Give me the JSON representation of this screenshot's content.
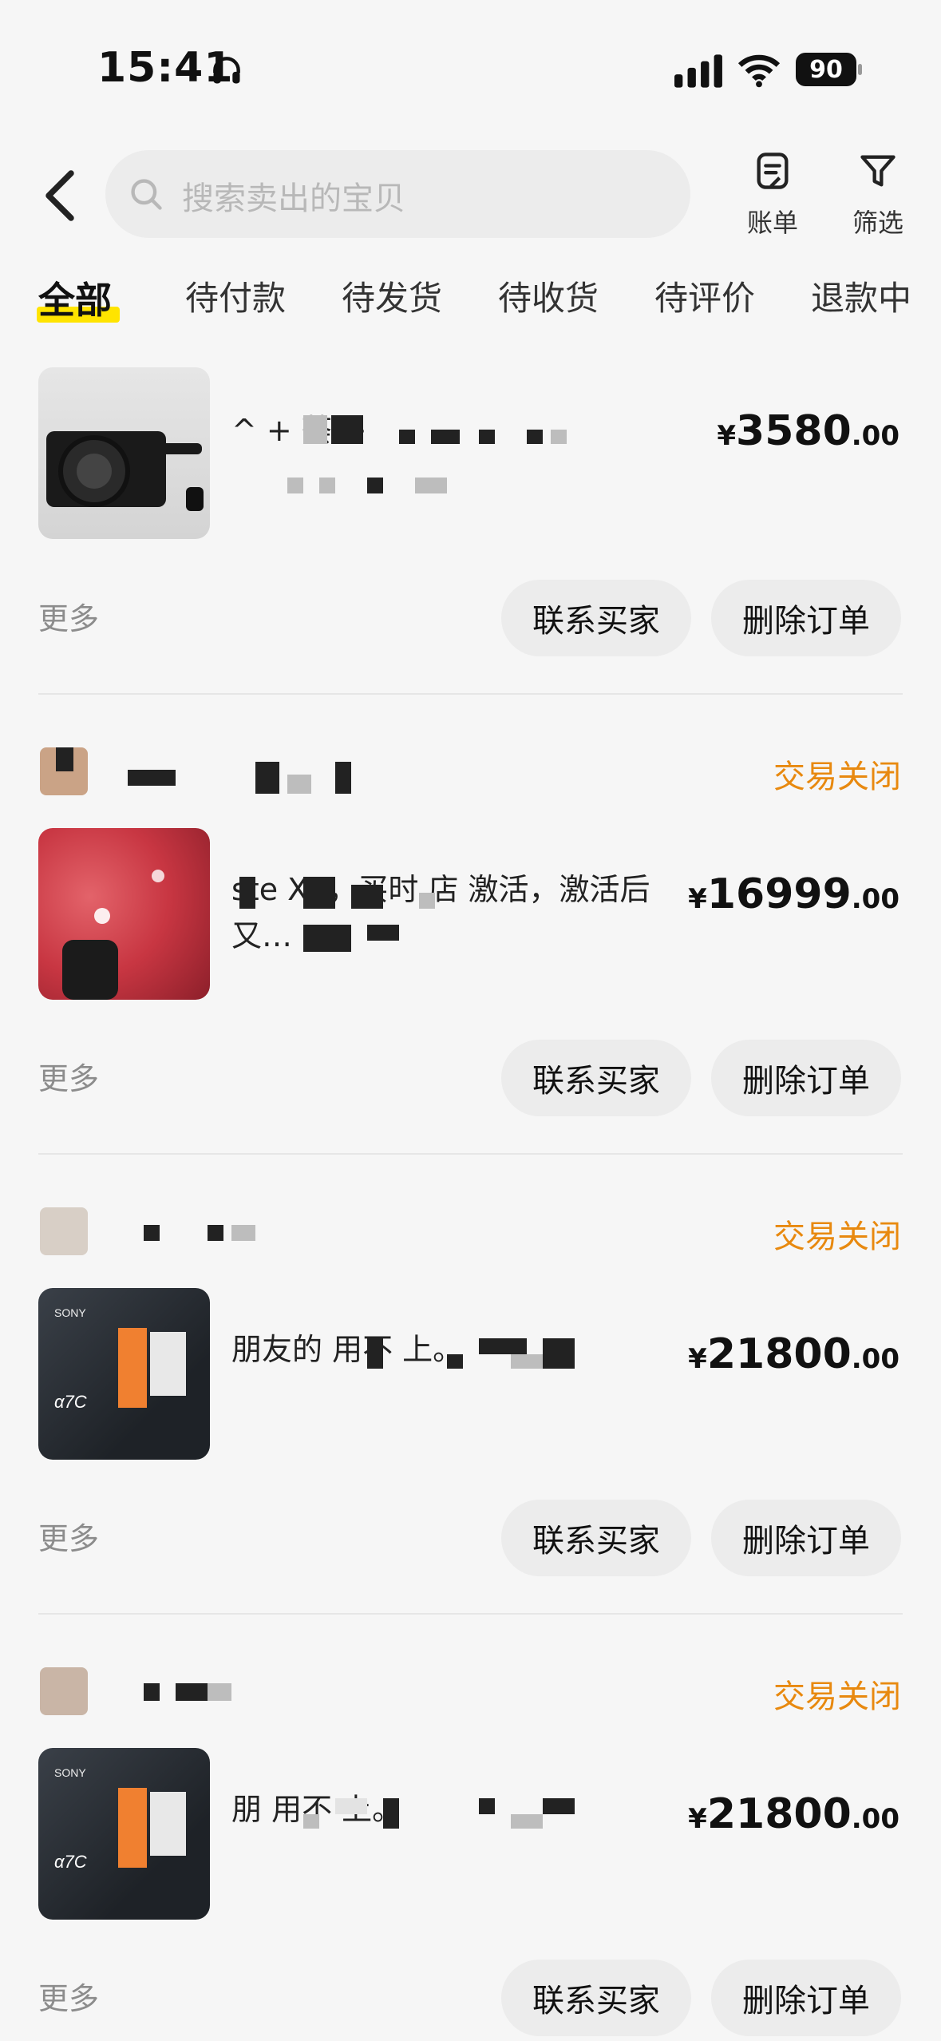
{
  "status_bar": {
    "time": "15:41",
    "battery": "90",
    "icons": [
      "headphones-icon",
      "signal-icon",
      "wifi-icon",
      "battery-icon"
    ]
  },
  "nav": {
    "search_placeholder": "搜索卖出的宝贝",
    "bill_label": "账单",
    "filter_label": "筛选"
  },
  "tabs": [
    "全部",
    "待付款",
    "待发货",
    "待收货",
    "待评价",
    "退款中"
  ],
  "orders": [
    {
      "status": "",
      "title": "^ + 荟 +",
      "price_currency": "¥",
      "price_int": "3580",
      "price_dec": ".00",
      "more": "更多",
      "contact_label": "联系买家",
      "delete_label": "删除订单"
    },
    {
      "status": "交易关闭",
      "title": "ste X6，买时 店 激活，激活后又…",
      "price_currency": "¥",
      "price_int": "16999",
      "price_dec": ".00",
      "more": "更多",
      "contact_label": "联系买家",
      "delete_label": "删除订单"
    },
    {
      "status": "交易关闭",
      "title": "朋友的 用不 上。",
      "price_currency": "¥",
      "price_int": "21800",
      "price_dec": ".00",
      "more": "更多",
      "contact_label": "联系买家",
      "delete_label": "删除订单"
    },
    {
      "status": "交易关闭",
      "title": "朋 用不 上。",
      "price_currency": "¥",
      "price_int": "21800",
      "price_dec": ".00",
      "more": "更多",
      "contact_label": "联系买家",
      "delete_label": "删除订单"
    }
  ],
  "colors": {
    "background": "#f6f6f6",
    "accent_yellow": "#ffe400",
    "status_orange": "#e8890f",
    "button_bg": "#ececec"
  }
}
